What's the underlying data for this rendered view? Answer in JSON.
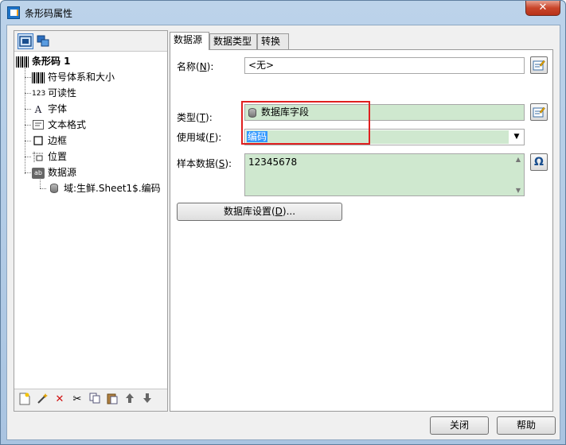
{
  "window": {
    "title": "条形码属性",
    "close_glyph": "✕"
  },
  "left_panel": {
    "tree": [
      {
        "label": "条形码 1",
        "icon": "barcode-icon",
        "level": 0,
        "bold": true
      },
      {
        "label": "符号体系和大小",
        "icon": "barcode-symbology-icon",
        "level": 1
      },
      {
        "label": "可读性",
        "icon": "readability-123-icon",
        "level": 1
      },
      {
        "label": "字体",
        "icon": "font-icon",
        "level": 1
      },
      {
        "label": "文本格式",
        "icon": "text-format-icon",
        "level": 1
      },
      {
        "label": "边框",
        "icon": "border-icon",
        "level": 1
      },
      {
        "label": "位置",
        "icon": "position-icon",
        "level": 1
      },
      {
        "label": "数据源",
        "icon": "data-source-icon",
        "level": 1
      },
      {
        "label": "域:生鲜.Sheet1$.编码",
        "icon": "database-icon",
        "level": 2
      }
    ]
  },
  "tabs": [
    {
      "label": "数据源",
      "active": true
    },
    {
      "label": "数据类型",
      "active": false
    },
    {
      "label": "转换",
      "active": false
    }
  ],
  "form": {
    "name_label_prefix": "名称(",
    "name_label_key": "N",
    "name_label_suffix": "):",
    "name_value": "<无>",
    "type_label_prefix": "类型(",
    "type_label_key": "T",
    "type_label_suffix": "):",
    "type_value": "数据库字段",
    "field_label_prefix": "使用域(",
    "field_label_key": "F",
    "field_label_suffix": "):",
    "field_value": "编码",
    "sample_label_prefix": "样本数据(",
    "sample_label_key": "S",
    "sample_label_suffix": "):",
    "sample_value": "12345678",
    "db_settings_prefix": "数据库设置(",
    "db_settings_key": "D",
    "db_settings_suffix": ")...",
    "omega_glyph": "Ω"
  },
  "buttons": {
    "close": "关闭",
    "help": "帮助"
  },
  "colors": {
    "field_green": "#cfe8cf",
    "highlight_red": "#e02020",
    "selection_blue": "#3399ff"
  }
}
